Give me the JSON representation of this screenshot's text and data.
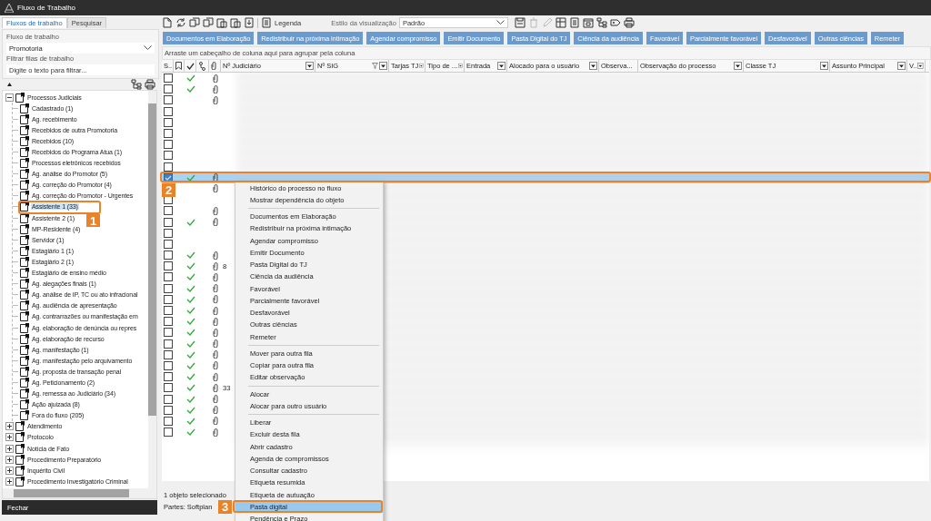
{
  "window": {
    "title": "Fluxo de Trabalho"
  },
  "left_panel": {
    "tabs": [
      {
        "label": "Fluxos de trabalho",
        "selected": true
      },
      {
        "label": "Pesquisar",
        "selected": false
      }
    ],
    "workflow_label": "Fluxo de trabalho",
    "workflow_value": "Promotoria",
    "filter_label": "Filtrar filas de trabalho",
    "filter_placeholder": "Digite o texto para filtrar...",
    "tree": [
      {
        "label": "Processos Judiciais",
        "expanded": true,
        "selected": false,
        "children": [
          {
            "label": "Cadastrado (1)",
            "selected": false
          },
          {
            "label": "Ag. recebimento",
            "selected": false
          },
          {
            "label": "Recebidos de outra Promotoria",
            "selected": false
          },
          {
            "label": "Recebidos (10)",
            "selected": false
          },
          {
            "label": "Recebidos do Programa Atua (1)",
            "selected": false
          },
          {
            "label": "Processos eletrônicos recebidos",
            "selected": false
          },
          {
            "label": "Ag. análise do Promotor (5)",
            "selected": false
          },
          {
            "label": "Ag. correção do Promotor (4)",
            "selected": false
          },
          {
            "label": "Ag. correção do Promotor - Urgentes",
            "selected": false
          },
          {
            "label": "Assistente 1 (33)",
            "selected": true
          },
          {
            "label": "Assistente 2 (1)",
            "selected": false
          },
          {
            "label": "MP-Residente (4)",
            "selected": false
          },
          {
            "label": "Servidor (1)",
            "selected": false
          },
          {
            "label": "Estagiário 1 (1)",
            "selected": false
          },
          {
            "label": "Estagiário 2 (1)",
            "selected": false
          },
          {
            "label": "Estagiário de ensino médio",
            "selected": false
          },
          {
            "label": "Ag. alegações finais (1)",
            "selected": false
          },
          {
            "label": "Ag. análise de IP, TC ou ato infracional",
            "selected": false
          },
          {
            "label": "Ag. audiência de apresentação",
            "selected": false
          },
          {
            "label": "Ag. contrarrazões ou manifestação em",
            "selected": false
          },
          {
            "label": "Ag. elaboração de denúncia ou repres",
            "selected": false
          },
          {
            "label": "Ag. elaboração de recurso",
            "selected": false
          },
          {
            "label": "Ag. manifestação (1)",
            "selected": false
          },
          {
            "label": "Ag. manifestação pelo arquivamento",
            "selected": false
          },
          {
            "label": "Ag. proposta de transação penal",
            "selected": false
          },
          {
            "label": "Ag. Peticionamento (2)",
            "selected": false
          },
          {
            "label": "Ag. remessa ao Judiciário (34)",
            "selected": false
          },
          {
            "label": "Ação ajuizada (8)",
            "selected": false
          },
          {
            "label": "Fora do fluxo (205)",
            "selected": false
          }
        ]
      },
      {
        "label": "Atendimento",
        "expanded": false,
        "selected": false
      },
      {
        "label": "Protocolo",
        "expanded": false,
        "selected": false
      },
      {
        "label": "Notícia de Fato",
        "expanded": false,
        "selected": false
      },
      {
        "label": "Procedimento Preparatório",
        "expanded": false,
        "selected": false
      },
      {
        "label": "Inquérito Civil",
        "expanded": false,
        "selected": false
      },
      {
        "label": "Procedimento Investigatório Criminal",
        "expanded": false,
        "selected": false
      }
    ],
    "close_button": "Fechar"
  },
  "toolbar": {
    "legend_label": "Legenda",
    "view_style_label": "Estilo da visualização",
    "view_style": "Padrão",
    "right_tools": [
      {
        "disabled": false
      },
      {
        "disabled": true
      },
      {
        "disabled": true
      },
      {
        "disabled": false
      },
      {
        "disabled": false
      },
      {
        "disabled": false
      },
      {
        "disabled": false
      },
      {
        "disabled": false
      },
      {
        "disabled": false
      }
    ]
  },
  "action_buttons": [
    "Documentos em Elaboração",
    "Redistribuir na próxima intimação",
    "Agendar compromisso",
    "Emitir Documento",
    "Pasta Digital do TJ",
    "Ciência da audiência",
    "Favorável",
    "Parcialmente favorável",
    "Desfavorável",
    "Outras ciências",
    "Remeter"
  ],
  "group_hint": "Arraste um cabeçalho de coluna aqui para agrupar pela coluna",
  "columns": [
    {
      "kind": "text",
      "label": "S.."
    },
    {
      "kind": "bookmark"
    },
    {
      "kind": "check"
    },
    {
      "kind": "hierarchy"
    },
    {
      "kind": "attachment"
    },
    {
      "kind": "text",
      "label": "Nº Judiciário",
      "has_filter": true,
      "filtered": false
    },
    {
      "kind": "text",
      "label": "Nº SIG",
      "has_filter": true,
      "filtered": true
    },
    {
      "kind": "text",
      "label": "Tarjas TJ",
      "has_filter": true,
      "filtered": false
    },
    {
      "kind": "text",
      "label": "Tipo de ...",
      "has_filter": true,
      "filtered": false
    },
    {
      "kind": "text",
      "label": "Entrada",
      "has_filter": true,
      "filtered": false
    },
    {
      "kind": "text",
      "label": "Alocado para o usuário",
      "has_filter": true,
      "filtered": false
    },
    {
      "kind": "text",
      "label": "Observa...",
      "has_filter": false,
      "filtered": false
    },
    {
      "kind": "text",
      "label": "Observação do processo",
      "has_filter": true,
      "filtered": false
    },
    {
      "kind": "text",
      "label": "Classe TJ",
      "has_filter": true,
      "filtered": false
    },
    {
      "kind": "text",
      "label": "Assunto Principal",
      "has_filter": true,
      "filtered": false
    },
    {
      "kind": "text",
      "label": "V..",
      "has_filter": true,
      "filtered": false
    }
  ],
  "rows": [
    {
      "checked": false,
      "selected": false,
      "done": true,
      "attachment": true
    },
    {
      "checked": false,
      "selected": false,
      "done": true,
      "attachment": true
    },
    {
      "checked": false,
      "selected": false,
      "done": false,
      "attachment": true
    },
    {
      "checked": false,
      "selected": false,
      "done": false,
      "attachment": false
    },
    {
      "checked": false,
      "selected": false,
      "done": false,
      "attachment": false
    },
    {
      "checked": false,
      "selected": false,
      "done": false,
      "attachment": false
    },
    {
      "checked": false,
      "selected": false,
      "done": false,
      "attachment": false
    },
    {
      "checked": false,
      "selected": false,
      "done": false,
      "attachment": false
    },
    {
      "checked": false,
      "selected": false,
      "done": false,
      "attachment": false
    },
    {
      "checked": true,
      "selected": true,
      "done": true,
      "attachment": true
    },
    {
      "selected": false,
      "done": false,
      "attachment": true
    },
    {
      "checked": false,
      "selected": false,
      "done": false,
      "attachment": false
    },
    {
      "checked": false,
      "selected": false,
      "done": false,
      "attachment": true
    },
    {
      "checked": false,
      "selected": false,
      "done": true,
      "attachment": true
    },
    {
      "checked": false,
      "selected": false,
      "done": false,
      "attachment": false
    },
    {
      "checked": false,
      "selected": false,
      "done": false,
      "attachment": false
    },
    {
      "checked": false,
      "selected": false,
      "done": true,
      "attachment": true
    },
    {
      "checked": false,
      "selected": false,
      "done": true,
      "attachment": true,
      "judicial_number": "8"
    },
    {
      "checked": false,
      "selected": false,
      "done": true,
      "attachment": true
    },
    {
      "checked": false,
      "selected": false,
      "done": true,
      "attachment": true
    },
    {
      "checked": false,
      "selected": false,
      "done": true,
      "attachment": true
    },
    {
      "checked": false,
      "selected": false,
      "done": true,
      "attachment": true
    },
    {
      "checked": false,
      "selected": false,
      "done": true,
      "attachment": true
    },
    {
      "checked": false,
      "selected": false,
      "done": true,
      "attachment": true
    },
    {
      "checked": false,
      "selected": false,
      "done": true,
      "attachment": true
    },
    {
      "checked": false,
      "selected": false,
      "done": true,
      "attachment": true
    },
    {
      "checked": false,
      "selected": false,
      "done": true,
      "attachment": true
    },
    {
      "checked": false,
      "selected": false,
      "done": true,
      "attachment": true
    },
    {
      "checked": false,
      "selected": false,
      "done": true,
      "attachment": true,
      "judicial_number": "33"
    },
    {
      "checked": false,
      "selected": false,
      "done": true,
      "attachment": true
    },
    {
      "checked": false,
      "selected": false,
      "done": true,
      "attachment": true
    },
    {
      "checked": false,
      "selected": false,
      "done": true,
      "attachment": true
    },
    {
      "checked": false,
      "selected": false,
      "done": true,
      "attachment": true
    }
  ],
  "status": {
    "selection": "1 objeto selecionado",
    "parties": "Partes: Softplan"
  },
  "context_menu": [
    {
      "kind": "item",
      "label": "Histórico do processo no fluxo",
      "selected": false
    },
    {
      "kind": "item",
      "label": "Mostrar dependência do objeto",
      "selected": false
    },
    {
      "kind": "separator"
    },
    {
      "kind": "item",
      "label": "Documentos em Elaboração",
      "selected": false
    },
    {
      "kind": "item",
      "label": "Redistribuir na próxima intimação",
      "selected": false
    },
    {
      "kind": "item",
      "label": "Agendar compromisso",
      "selected": false
    },
    {
      "kind": "item",
      "label": "Emitir Documento",
      "selected": false
    },
    {
      "kind": "item",
      "label": "Pasta Digital do TJ",
      "selected": false
    },
    {
      "kind": "item",
      "label": "Ciência da audiência",
      "selected": false
    },
    {
      "kind": "item",
      "label": "Favorável",
      "selected": false
    },
    {
      "kind": "item",
      "label": "Parcialmente favorável",
      "selected": false
    },
    {
      "kind": "item",
      "label": "Desfavorável",
      "selected": false
    },
    {
      "kind": "item",
      "label": "Outras ciências",
      "selected": false
    },
    {
      "kind": "item",
      "label": "Remeter",
      "selected": false
    },
    {
      "kind": "separator"
    },
    {
      "kind": "item",
      "label": "Mover para outra fila",
      "selected": false
    },
    {
      "kind": "item",
      "label": "Copiar para outra fila",
      "selected": false
    },
    {
      "kind": "item",
      "label": "Editar observação",
      "selected": false
    },
    {
      "kind": "separator"
    },
    {
      "kind": "item",
      "label": "Alocar",
      "selected": false
    },
    {
      "kind": "item",
      "label": "Alocar para outro usuário",
      "selected": false
    },
    {
      "kind": "separator"
    },
    {
      "kind": "item",
      "label": "Liberar",
      "selected": false
    },
    {
      "kind": "item",
      "label": "Excluir desta fila",
      "selected": false
    },
    {
      "kind": "item",
      "label": "Abrir cadastro",
      "selected": false
    },
    {
      "kind": "item",
      "label": "Agenda de compromissos",
      "selected": false
    },
    {
      "kind": "item",
      "label": "Consultar cadastro",
      "selected": false
    },
    {
      "kind": "item",
      "label": "Etiqueta resumida",
      "selected": false
    },
    {
      "kind": "item",
      "label": "Etiqueta de autuação",
      "selected": false
    },
    {
      "kind": "item",
      "label": "Pasta digital",
      "selected": true
    },
    {
      "kind": "item",
      "label": "Pendência e Prazo",
      "selected": false
    }
  ],
  "callouts": [
    {
      "number": "1"
    },
    {
      "number": "2"
    },
    {
      "number": "3"
    }
  ]
}
